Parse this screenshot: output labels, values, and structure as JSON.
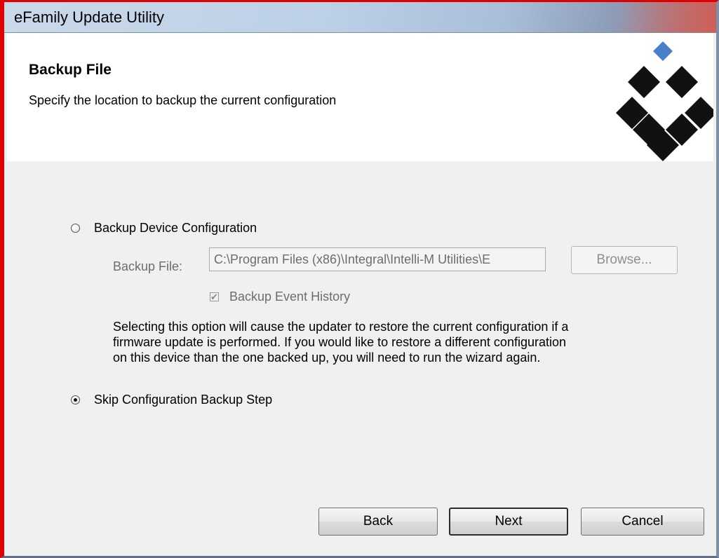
{
  "window": {
    "title": "eFamily Update Utility"
  },
  "header": {
    "title": "Backup File",
    "subtitle": "Specify the location to backup the current configuration"
  },
  "options": {
    "backup_device": {
      "label": "Backup Device Configuration",
      "selected": false
    },
    "backup_file_label": "Backup File:",
    "backup_file_value": "C:\\Program Files (x86)\\Integral\\Intelli-M Utilities\\E",
    "browse_label": "Browse...",
    "event_history": {
      "label": "Backup Event History",
      "checked": true,
      "enabled": false
    },
    "description_lines": [
      "Selecting this option will cause the updater to restore the current configuration if a",
      "firmware update is performed.  If you would like to restore a different configuration",
      "on this device than the one backed up, you will need to run the wizard again."
    ],
    "skip_backup": {
      "label": "Skip Configuration Backup Step",
      "selected": true
    }
  },
  "buttons": {
    "back": "Back",
    "next": "Next",
    "cancel": "Cancel"
  },
  "colors": {
    "frame_accent": "#e00000",
    "logo_blue": "#4a7fc9",
    "logo_black": "#111111"
  }
}
